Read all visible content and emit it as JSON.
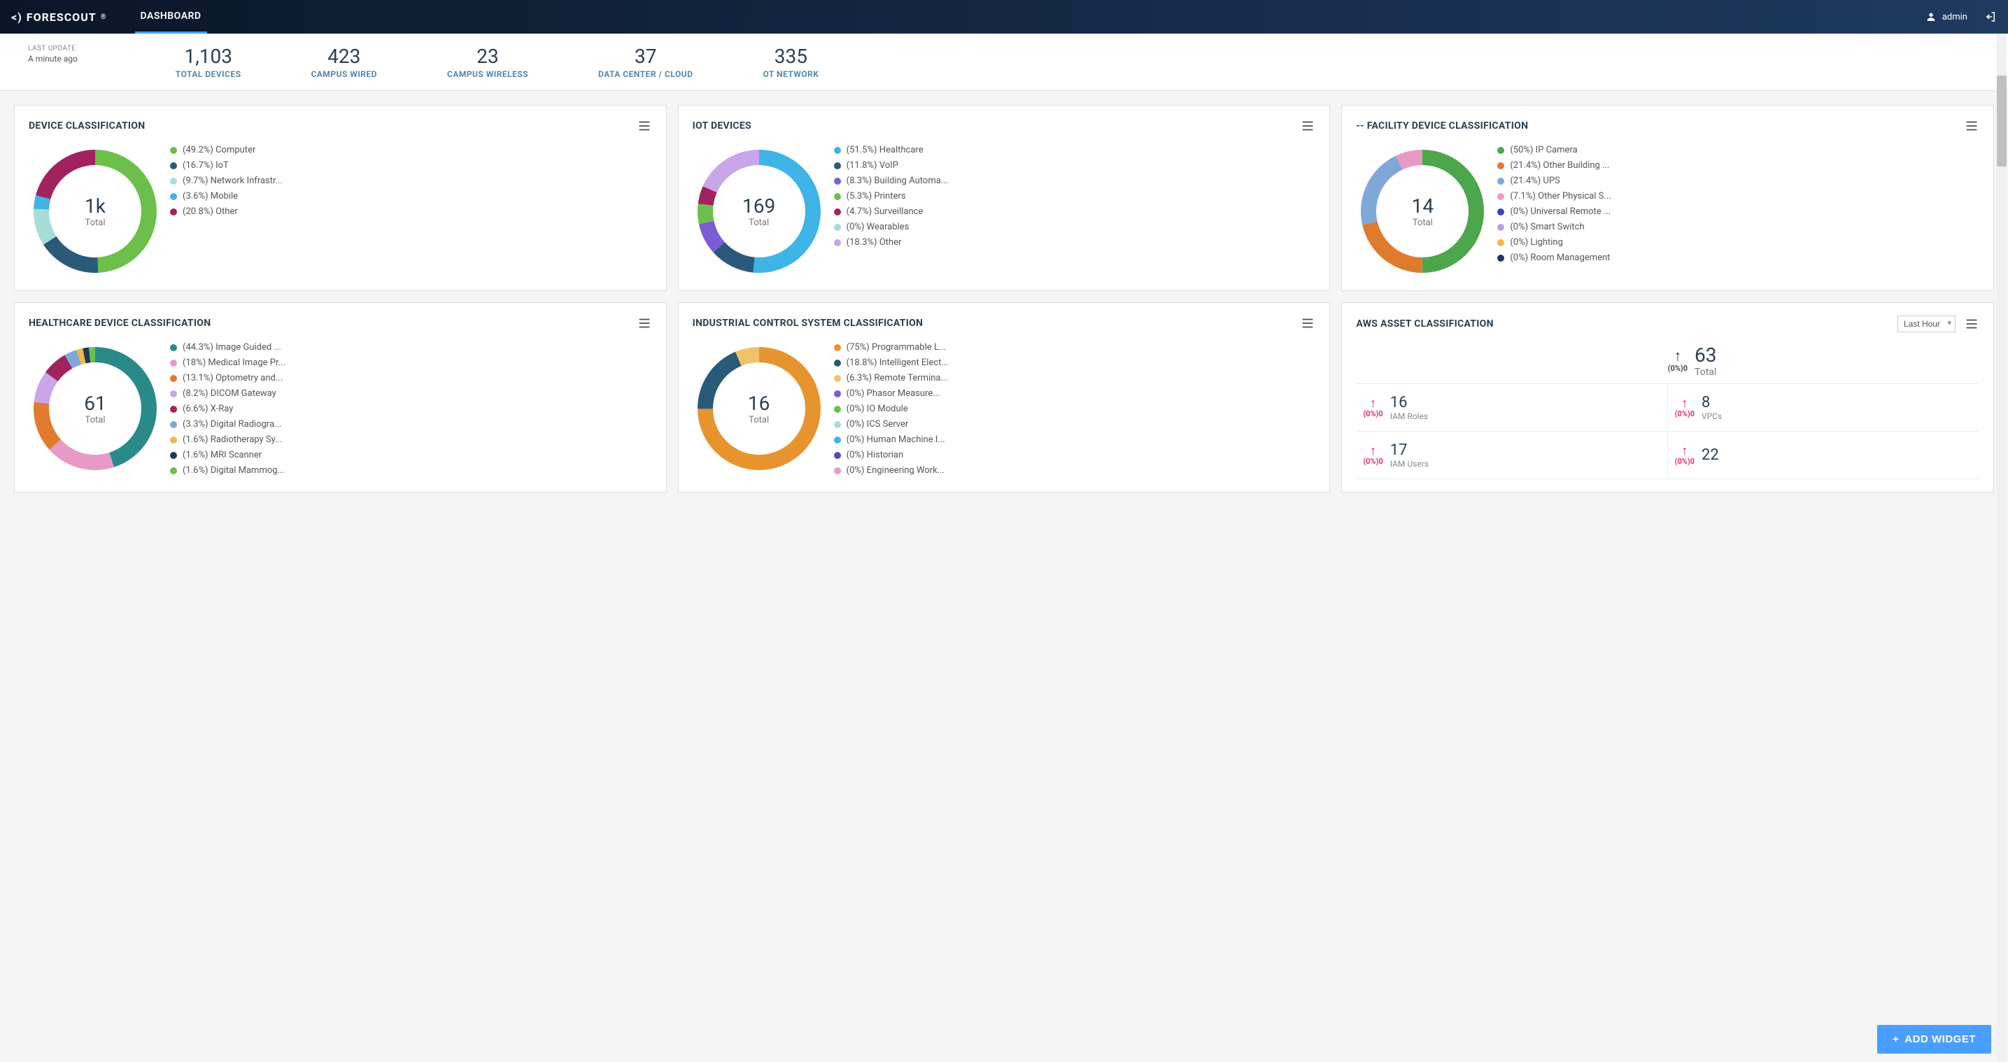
{
  "header": {
    "brand": "FORESCOUT",
    "nav_tab": "DASHBOARD",
    "user_label": "admin"
  },
  "summary": {
    "last_update_label": "LAST UPDATE",
    "last_update_time": "A minute ago",
    "items": [
      {
        "value": "1,103",
        "label": "TOTAL DEVICES"
      },
      {
        "value": "423",
        "label": "CAMPUS WIRED"
      },
      {
        "value": "23",
        "label": "CAMPUS WIRELESS"
      },
      {
        "value": "37",
        "label": "DATA CENTER / CLOUD"
      },
      {
        "value": "335",
        "label": "OT NETWORK"
      }
    ]
  },
  "widgets": [
    {
      "title": "DEVICE CLASSIFICATION",
      "total_value": "1k",
      "total_label": "Total",
      "chart_data": {
        "type": "pie",
        "series": [
          {
            "name": "Computer",
            "pct": 49.2,
            "color": "#6cbf4b"
          },
          {
            "name": "IoT",
            "pct": 16.7,
            "color": "#2a5a7a"
          },
          {
            "name": "Network Infrastr...",
            "pct": 9.7,
            "color": "#a8dcd9"
          },
          {
            "name": "Mobile",
            "pct": 3.6,
            "color": "#3fb4e6"
          },
          {
            "name": "Other",
            "pct": 20.8,
            "color": "#a0235f"
          }
        ]
      },
      "legend": [
        "(49.2%) Computer",
        "(16.7%) IoT",
        "(9.7%) Network Infrastr...",
        "(3.6%) Mobile",
        "(20.8%) Other"
      ]
    },
    {
      "title": "IOT DEVICES",
      "total_value": "169",
      "total_label": "Total",
      "chart_data": {
        "type": "pie",
        "series": [
          {
            "name": "Healthcare",
            "pct": 51.5,
            "color": "#3fb4e6"
          },
          {
            "name": "VoIP",
            "pct": 11.8,
            "color": "#2a5a7a"
          },
          {
            "name": "Building Automa...",
            "pct": 8.3,
            "color": "#7b5cd6"
          },
          {
            "name": "Printers",
            "pct": 5.3,
            "color": "#6cbf4b"
          },
          {
            "name": "Surveillance",
            "pct": 4.7,
            "color": "#a0235f"
          },
          {
            "name": "Wearables",
            "pct": 0,
            "color": "#a8dcd9"
          },
          {
            "name": "Other",
            "pct": 18.3,
            "color": "#c9a6e8"
          }
        ]
      },
      "legend": [
        "(51.5%) Healthcare",
        "(11.8%) VoIP",
        "(8.3%) Building Automa...",
        "(5.3%) Printers",
        "(4.7%) Surveillance",
        "(0%) Wearables",
        "(18.3%) Other"
      ]
    },
    {
      "title": "-- FACILITY DEVICE CLASSIFICATION",
      "total_value": "14",
      "total_label": "Total",
      "chart_data": {
        "type": "pie",
        "series": [
          {
            "name": "IP Camera",
            "pct": 50,
            "color": "#4ca64c"
          },
          {
            "name": "Other Building ...",
            "pct": 21.4,
            "color": "#e07b2e"
          },
          {
            "name": "UPS",
            "pct": 21.4,
            "color": "#7fa8d9"
          },
          {
            "name": "Other Physical S...",
            "pct": 7.1,
            "color": "#e89ac7"
          },
          {
            "name": "Universal Remote ...",
            "pct": 0,
            "color": "#3b3fc7"
          },
          {
            "name": "Smart Switch",
            "pct": 0,
            "color": "#b89fe6"
          },
          {
            "name": "Lighting",
            "pct": 0,
            "color": "#f0b84a"
          },
          {
            "name": "Room Management",
            "pct": 0,
            "color": "#1a3a5a"
          }
        ]
      },
      "legend": [
        "(50%) IP Camera",
        "(21.4%) Other Building ...",
        "(21.4%) UPS",
        "(7.1%) Other Physical S...",
        "(0%) Universal Remote ...",
        "(0%) Smart Switch",
        "(0%) Lighting",
        "(0%) Room Management"
      ]
    },
    {
      "title": "HEALTHCARE DEVICE CLASSIFICATION",
      "total_value": "61",
      "total_label": "Total",
      "chart_data": {
        "type": "pie",
        "series": [
          {
            "name": "Image Guided ...",
            "pct": 44.3,
            "color": "#2a8a8a"
          },
          {
            "name": "Medical Image Pr...",
            "pct": 18,
            "color": "#e89ac7"
          },
          {
            "name": "Optometry and...",
            "pct": 13.1,
            "color": "#e07b2e"
          },
          {
            "name": "DICOM Gateway",
            "pct": 8.2,
            "color": "#c9a6e8"
          },
          {
            "name": "X-Ray",
            "pct": 6.6,
            "color": "#a0235f"
          },
          {
            "name": "Digital Radiogra...",
            "pct": 3.3,
            "color": "#7fa8d9"
          },
          {
            "name": "Radiotherapy Sy...",
            "pct": 1.6,
            "color": "#f0b84a"
          },
          {
            "name": "MRI Scanner",
            "pct": 1.6,
            "color": "#1a3a5a"
          },
          {
            "name": "Digital Mammog...",
            "pct": 1.6,
            "color": "#6cbf4b"
          }
        ]
      },
      "legend": [
        "(44.3%) Image Guided ...",
        "(18%) Medical Image Pr...",
        "(13.1%) Optometry and...",
        "(8.2%) DICOM Gateway",
        "(6.6%) X-Ray",
        "(3.3%) Digital Radiogra...",
        "(1.6%) Radiotherapy Sy...",
        "(1.6%) MRI Scanner",
        "(1.6%) Digital Mammog..."
      ]
    },
    {
      "title": "INDUSTRIAL CONTROL SYSTEM CLASSIFICATION",
      "total_value": "16",
      "total_label": "Total",
      "chart_data": {
        "type": "pie",
        "series": [
          {
            "name": "Programmable L...",
            "pct": 75,
            "color": "#e8942e"
          },
          {
            "name": "Intelligent Elect...",
            "pct": 18.8,
            "color": "#2a5a7a"
          },
          {
            "name": "Remote Termina...",
            "pct": 6.3,
            "color": "#f0c26a"
          },
          {
            "name": "Phasor Measure...",
            "pct": 0,
            "color": "#7b5cd6"
          },
          {
            "name": "IO Module",
            "pct": 0,
            "color": "#6cbf4b"
          },
          {
            "name": "ICS Server",
            "pct": 0,
            "color": "#a8dcd9"
          },
          {
            "name": "Human Machine I...",
            "pct": 0,
            "color": "#3fb4e6"
          },
          {
            "name": "Historian",
            "pct": 0,
            "color": "#5a4aa8"
          },
          {
            "name": "Engineering Work...",
            "pct": 0,
            "color": "#e89ac7"
          }
        ]
      },
      "legend": [
        "(75%) Programmable L...",
        "(18.8%) Intelligent Elect...",
        "(6.3%) Remote Termina...",
        "(0%) Phasor Measure...",
        "(0%) IO Module",
        "(0%) ICS Server",
        "(0%) Human Machine I...",
        "(0%) Historian",
        "(0%) Engineering Work..."
      ]
    }
  ],
  "aws_widget": {
    "title": "AWS ASSET CLASSIFICATION",
    "range_selected": "Last Hour",
    "total_value": "63",
    "total_label": "Total",
    "total_pct": "(0%)0",
    "cells": [
      {
        "value": "16",
        "label": "IAM Roles",
        "pct": "(0%)0"
      },
      {
        "value": "8",
        "label": "VPCs",
        "pct": "(0%)0"
      },
      {
        "value": "17",
        "label": "IAM Users",
        "pct": "(0%)0"
      },
      {
        "value": "22",
        "label": "",
        "pct": "(0%)0"
      }
    ]
  },
  "add_widget_label": "ADD WIDGET"
}
